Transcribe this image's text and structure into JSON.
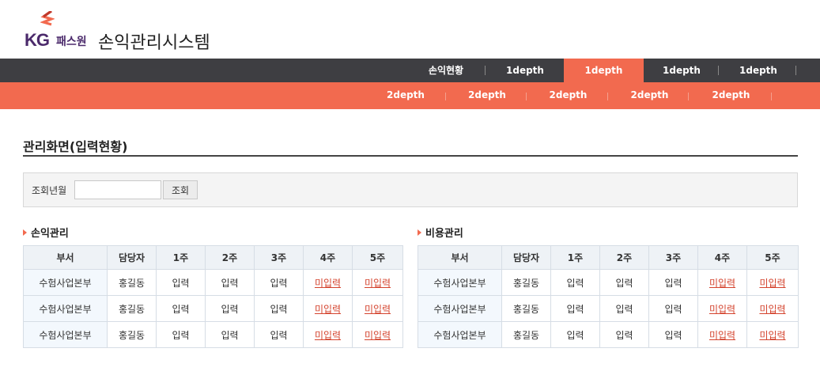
{
  "brand": {
    "logo_kg": "KG",
    "logo_text": "패스원",
    "app_title": "손익관리시스템"
  },
  "gnb": {
    "items": [
      "손익현황",
      "1depth",
      "1depth",
      "1depth",
      "1depth"
    ],
    "active_index": 2,
    "active_color": "#f26a4f",
    "bar_color": "#3e3e42"
  },
  "lnb": {
    "items": [
      "2depth",
      "2depth",
      "2depth",
      "2depth",
      "2depth"
    ]
  },
  "page": {
    "title": "관리화면(입력현황)"
  },
  "search": {
    "label": "조회년월",
    "value": "",
    "placeholder": "",
    "button": "조회"
  },
  "tables": [
    {
      "title": "손익관리",
      "headers": [
        "부서",
        "담당자",
        "1주",
        "2주",
        "3주",
        "4주",
        "5주"
      ],
      "rows": [
        [
          "수험사업본부",
          "홍길동",
          "입력",
          "입력",
          "입력",
          "미입력",
          "미입력"
        ],
        [
          "수험사업본부",
          "홍길동",
          "입력",
          "입력",
          "입력",
          "미입력",
          "미입력"
        ],
        [
          "수험사업본부",
          "홍길동",
          "입력",
          "입력",
          "입력",
          "미입력",
          "미입력"
        ]
      ]
    },
    {
      "title": "비용관리",
      "headers": [
        "부서",
        "담당자",
        "1주",
        "2주",
        "3주",
        "4주",
        "5주"
      ],
      "rows": [
        [
          "수험사업본부",
          "홍길동",
          "입력",
          "입력",
          "입력",
          "미입력",
          "미입력"
        ],
        [
          "수험사업본부",
          "홍길동",
          "입력",
          "입력",
          "입력",
          "미입력",
          "미입력"
        ],
        [
          "수험사업본부",
          "홍길동",
          "입력",
          "입력",
          "입력",
          "미입력",
          "미입력"
        ]
      ]
    }
  ],
  "colors": {
    "accent": "#f26a4f",
    "link_missing": "#d4432d",
    "brand_purple": "#4b2a6b"
  }
}
